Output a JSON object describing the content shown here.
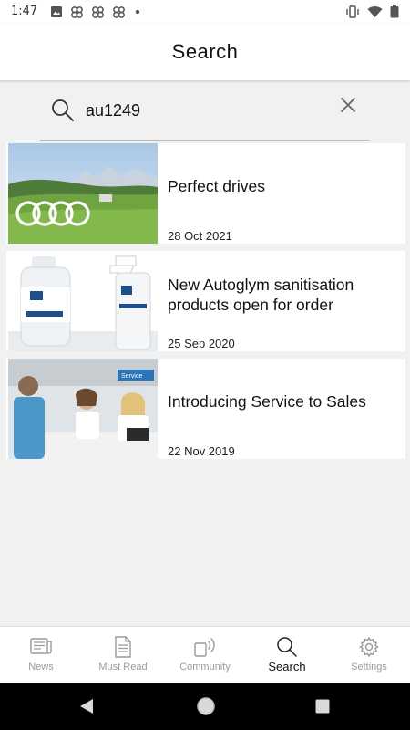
{
  "status_bar": {
    "time": "1:47",
    "notification_icons": [
      "image-icon",
      "pinwheel-icon",
      "pinwheel-icon",
      "pinwheel-icon",
      "dot-icon"
    ],
    "system_icons": [
      "vibrate-icon",
      "wifi-icon",
      "battery-icon"
    ]
  },
  "header": {
    "title": "Search"
  },
  "search": {
    "value": "au1249",
    "icon": "search-icon",
    "clear_icon": "close-icon"
  },
  "results": [
    {
      "title": "Perfect drives",
      "date": "28 Oct 2021",
      "thumb_logo": "audi-rings-logo"
    },
    {
      "title": "New Autoglym sanitisation products open for order",
      "date": "25 Sep 2020"
    },
    {
      "title": "Introducing Service to Sales",
      "date": "22 Nov 2019",
      "thumb_sign": "Service"
    }
  ],
  "bottom_nav": {
    "items": [
      {
        "label": "News",
        "icon": "news-icon"
      },
      {
        "label": "Must Read",
        "icon": "document-icon"
      },
      {
        "label": "Community",
        "icon": "community-icon"
      },
      {
        "label": "Search",
        "icon": "search-icon",
        "active": true
      },
      {
        "label": "Settings",
        "icon": "gear-icon"
      }
    ]
  },
  "system_nav": {
    "buttons": [
      "back-icon",
      "home-icon",
      "recents-icon"
    ]
  },
  "colors": {
    "background": "#f1f1f1",
    "surface": "#ffffff",
    "active_text": "#111111",
    "inactive_text": "#9a9a9a",
    "system_bar": "#000000"
  }
}
